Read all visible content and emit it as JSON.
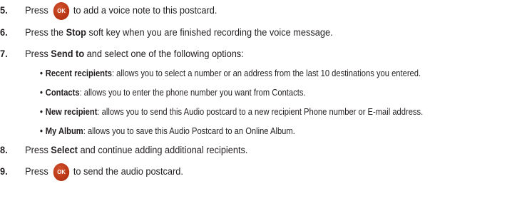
{
  "ok_button": {
    "label": "OK"
  },
  "steps": [
    {
      "num": "5.",
      "pre": "Press",
      "post": "to add a voice note to this postcard."
    },
    {
      "num": "6.",
      "pre": "Press the ",
      "bold": "Stop",
      "post": " soft key when you are finished recording the voice message."
    },
    {
      "num": "7.",
      "pre": "Press ",
      "bold": "Send to",
      "post": " and select one of the following options:"
    },
    {
      "num": "8.",
      "pre": "Press ",
      "bold": "Select",
      "post": " and continue adding additional recipients."
    },
    {
      "num": "9.",
      "pre": "Press",
      "post": "to send the audio postcard."
    }
  ],
  "bullets": [
    {
      "symbol": "•",
      "term": "Recent recipients",
      "desc": ": allows you to select a number or an address from the last 10 destinations you entered."
    },
    {
      "symbol": "•",
      "term": "Contacts",
      "desc": ": allows you to enter the phone number you want from Contacts."
    },
    {
      "symbol": "•",
      "term": "New recipient",
      "desc": ": allows you to send this Audio postcard to a new recipient Phone number or E-mail address."
    },
    {
      "symbol": "•",
      "term": "My Album",
      "desc": ": allows you to save this Audio Postcard to an Online Album."
    }
  ]
}
